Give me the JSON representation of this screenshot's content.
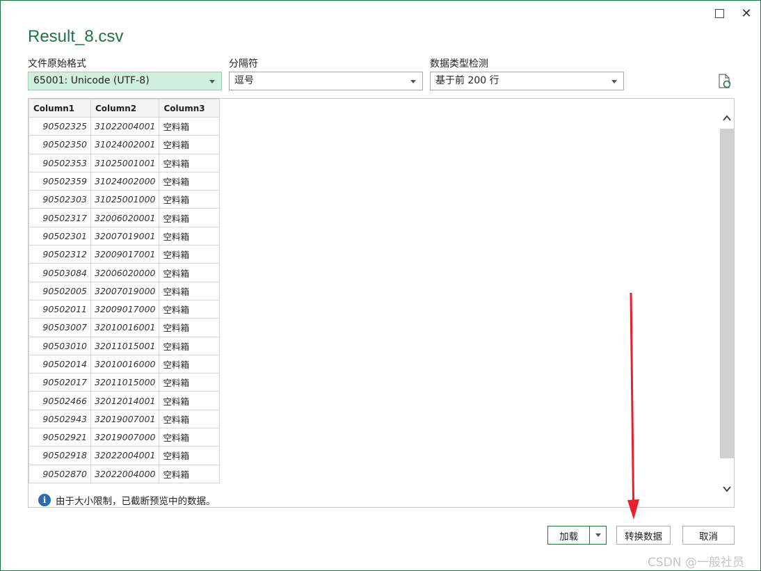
{
  "window": {
    "title": "Result_8.csv",
    "maximize_label": "",
    "close_label": "✕"
  },
  "options": {
    "file_origin": {
      "label": "文件原始格式",
      "value": "65001: Unicode (UTF-8)"
    },
    "delimiter": {
      "label": "分隔符",
      "value": "逗号"
    },
    "type_detection": {
      "label": "数据类型检测",
      "value": "基于前 200 行"
    }
  },
  "table": {
    "headers": [
      "Column1",
      "Column2",
      "Column3"
    ],
    "rows": [
      [
        "90502325",
        "31022004001",
        "空料箱"
      ],
      [
        "90502350",
        "31024002001",
        "空料箱"
      ],
      [
        "90502353",
        "31025001001",
        "空料箱"
      ],
      [
        "90502359",
        "31024002000",
        "空料箱"
      ],
      [
        "90502303",
        "31025001000",
        "空料箱"
      ],
      [
        "90502317",
        "32006020001",
        "空料箱"
      ],
      [
        "90502301",
        "32007019001",
        "空料箱"
      ],
      [
        "90502312",
        "32009017001",
        "空料箱"
      ],
      [
        "90503084",
        "32006020000",
        "空料箱"
      ],
      [
        "90502005",
        "32007019000",
        "空料箱"
      ],
      [
        "90502011",
        "32009017000",
        "空料箱"
      ],
      [
        "90503007",
        "32010016001",
        "空料箱"
      ],
      [
        "90503010",
        "32011015001",
        "空料箱"
      ],
      [
        "90502014",
        "32010016000",
        "空料箱"
      ],
      [
        "90502017",
        "32011015000",
        "空料箱"
      ],
      [
        "90502466",
        "32012014001",
        "空料箱"
      ],
      [
        "90502943",
        "32019007001",
        "空料箱"
      ],
      [
        "90502921",
        "32019007000",
        "空料箱"
      ],
      [
        "90502918",
        "32022004001",
        "空料箱"
      ],
      [
        "90502870",
        "32022004000",
        "空料箱"
      ]
    ]
  },
  "notice": {
    "icon_text": "i",
    "text": "由于大小限制，已截断预览中的数据。"
  },
  "buttons": {
    "load": "加载",
    "transform": "转换数据",
    "cancel": "取消"
  },
  "watermark": "CSDN @一般社员",
  "colors": {
    "accent": "#217346",
    "selected_field": "#cfeedd",
    "arrow": "#e8202a"
  }
}
